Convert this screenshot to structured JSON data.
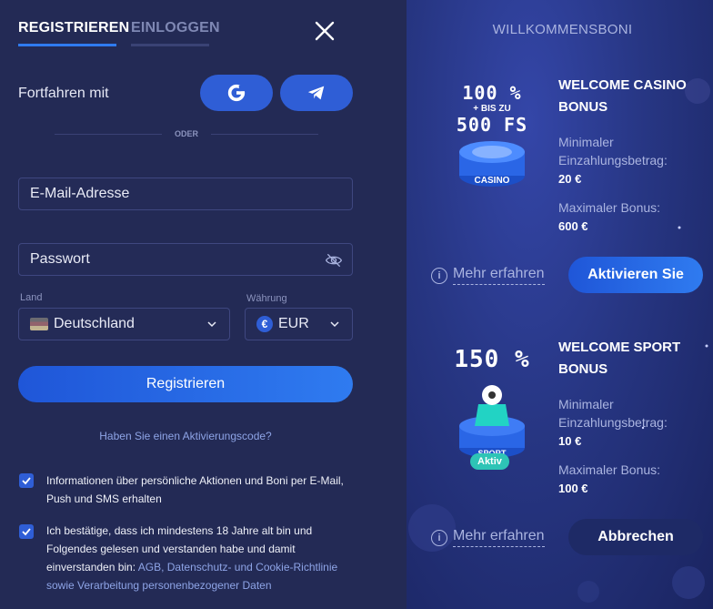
{
  "tabs": {
    "register": "REGISTRIEREN",
    "login": "EINLOGGEN"
  },
  "social": {
    "label": "Fortfahren mit",
    "divider": "ODER"
  },
  "form": {
    "email_placeholder": "E-Mail-Adresse",
    "password_placeholder": "Passwort",
    "country_label": "Land",
    "country_value": "Deutschland",
    "currency_label": "Währung",
    "currency_value": "EUR",
    "currency_symbol": "€",
    "register_button": "Registrieren",
    "activation_link": "Haben Sie einen Aktivierungscode?"
  },
  "checkboxes": [
    {
      "text": "Informationen über persönliche Aktionen und Boni per E-Mail, Push und SMS erhalten",
      "checked": true
    },
    {
      "text": "Ich bestätige, dass ich mindestens 18 Jahre alt bin und Folgendes gelesen und verstanden habe und damit einverstanden bin:",
      "links": "AGB, Datenschutz- und Cookie-Richtlinie sowie Verarbeitung personenbezogener Daten",
      "checked": true
    }
  ],
  "bonuses": {
    "title": "WILLKOMMENSBONI",
    "casino": {
      "percent": "100 %",
      "upto": "+ BIS ZU",
      "fs": "500 FS",
      "badge": "CASINO",
      "title": "WELCOME CASINO BONUS",
      "min_label": "Minimaler Einzahlungsbetrag:",
      "min_value": "20 €",
      "max_label": "Maximaler Bonus:",
      "max_value": "600 €",
      "more": "Mehr erfahren",
      "button": "Aktivieren Sie"
    },
    "sport": {
      "percent": "150 %",
      "badge": "SPORT",
      "status": "Aktiv",
      "title": "WELCOME SPORT BONUS",
      "min_label": "Minimaler Einzahlungsbetrag:",
      "min_value": "10 €",
      "max_label": "Maximaler Bonus:",
      "max_value": "100 €",
      "more": "Mehr erfahren",
      "button": "Abbrechen"
    }
  },
  "colors": {
    "accent": "#2f7bf0",
    "panel": "#232a55",
    "teal": "#2ec4b6"
  }
}
